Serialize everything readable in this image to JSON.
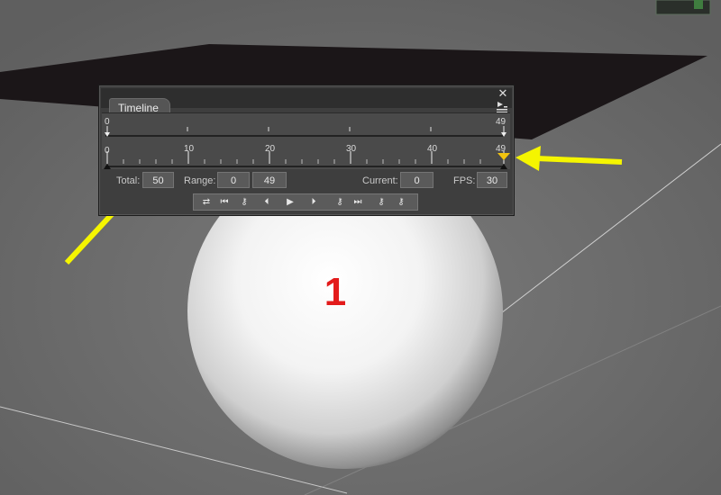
{
  "timeline": {
    "title": "Timeline",
    "close_glyph": "✕",
    "top_ruler": {
      "start_label": "0",
      "end_label": "49"
    },
    "main_ruler": {
      "tick_labels": [
        "0",
        "10",
        "20",
        "30",
        "40",
        "49"
      ]
    },
    "current_frame_marker_color": "#f2c40e",
    "fields": {
      "total_label": "Total:",
      "total_value": "50",
      "range_label": "Range:",
      "range_start": "0",
      "range_end": "49",
      "current_label": "Current:",
      "current_value": "0",
      "fps_label": "FPS:",
      "fps_value": "30"
    },
    "transport_buttons": [
      {
        "name": "loop-icon",
        "glyph": "⇄"
      },
      {
        "name": "prev-key-icon",
        "glyph": "⏮"
      },
      {
        "name": "key-icon",
        "glyph": "⚷"
      },
      {
        "name": "step-back-icon",
        "glyph": "⏴"
      },
      {
        "name": "play-icon",
        "glyph": "▶"
      },
      {
        "name": "step-forward-icon",
        "glyph": "⏵"
      },
      {
        "name": "add-key-icon",
        "glyph": "⚷"
      },
      {
        "name": "next-key-icon",
        "glyph": "⏭"
      },
      {
        "name": "remove-key-icon",
        "glyph": "⚷"
      },
      {
        "name": "insert-key-icon",
        "glyph": "⚷"
      }
    ]
  },
  "viewport": {
    "sphere_label": "1",
    "annotation_arrow_color": "#f5f500"
  }
}
